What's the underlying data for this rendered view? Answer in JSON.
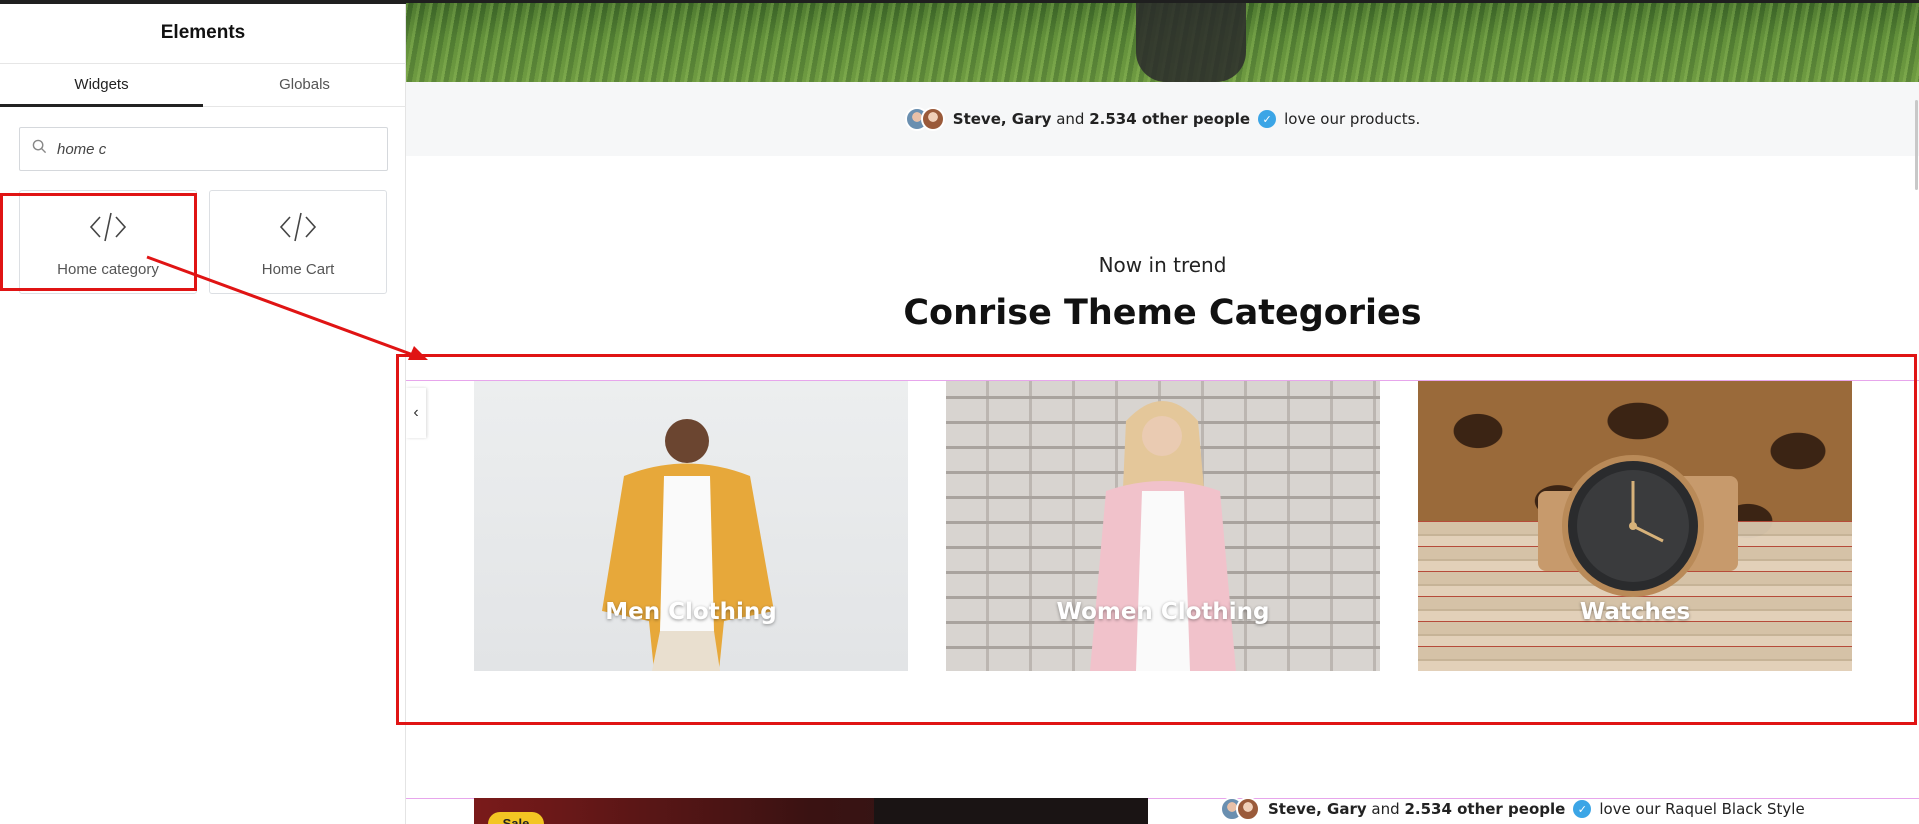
{
  "panel": {
    "title": "Elements",
    "tabs": [
      {
        "label": "Widgets",
        "active": true
      },
      {
        "label": "Globals",
        "active": false
      }
    ],
    "search": {
      "value": "home c",
      "icon": "search-icon"
    },
    "widgets": [
      {
        "label": "Home category",
        "icon": "code-icon"
      },
      {
        "label": "Home Cart",
        "icon": "code-icon"
      }
    ]
  },
  "preview": {
    "social_proof": {
      "names": "Steve, Gary",
      "and_text": "and",
      "count_text": "2.534 other people",
      "suffix": "love our products."
    },
    "section": {
      "subtitle": "Now in trend",
      "title": "Conrise Theme Categories"
    },
    "slider_prev_label": "‹",
    "categories": [
      {
        "label": "Men Clothing"
      },
      {
        "label": "Women Clothing"
      },
      {
        "label": "Watches"
      }
    ],
    "bottom": {
      "sale_badge": "Sale",
      "names": "Steve, Gary",
      "and_text": "and",
      "count_text": "2.534 other people",
      "suffix": "love our Raquel Black Style"
    },
    "floating_tools": [
      "feather-icon",
      "xampp-icon",
      "malwarebytes-icon"
    ]
  },
  "colors": {
    "annotation_red": "#e01414",
    "verified_blue": "#3ba5e6",
    "guide_pink": "#e7a6ec",
    "sale_yellow": "#f3c623"
  }
}
